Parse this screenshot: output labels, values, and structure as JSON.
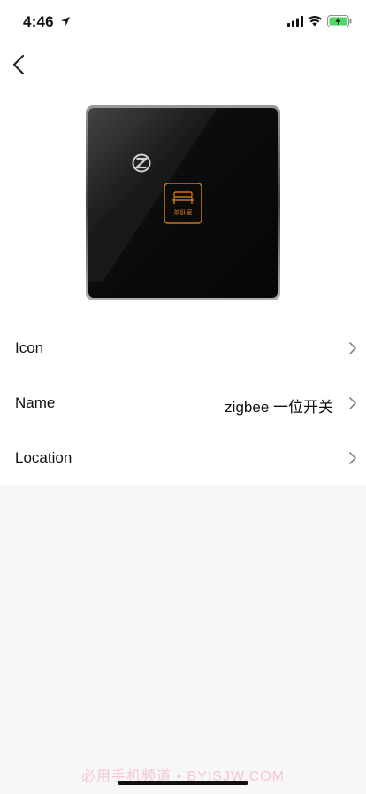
{
  "status_bar": {
    "time": "4:46"
  },
  "settings": {
    "rows": [
      {
        "label": "Icon",
        "value": ""
      },
      {
        "label": "Name",
        "value": "zigbee 一位开关"
      },
      {
        "label": "Location",
        "value": ""
      }
    ]
  },
  "device_image": {
    "button_text": "茶卧室"
  },
  "watermark": "必用手机频道 • BYISJW.COM",
  "colors": {
    "accent_orange": "#c7741f",
    "page_bg": "#f7f7f7",
    "panel_bg": "#ffffff"
  }
}
